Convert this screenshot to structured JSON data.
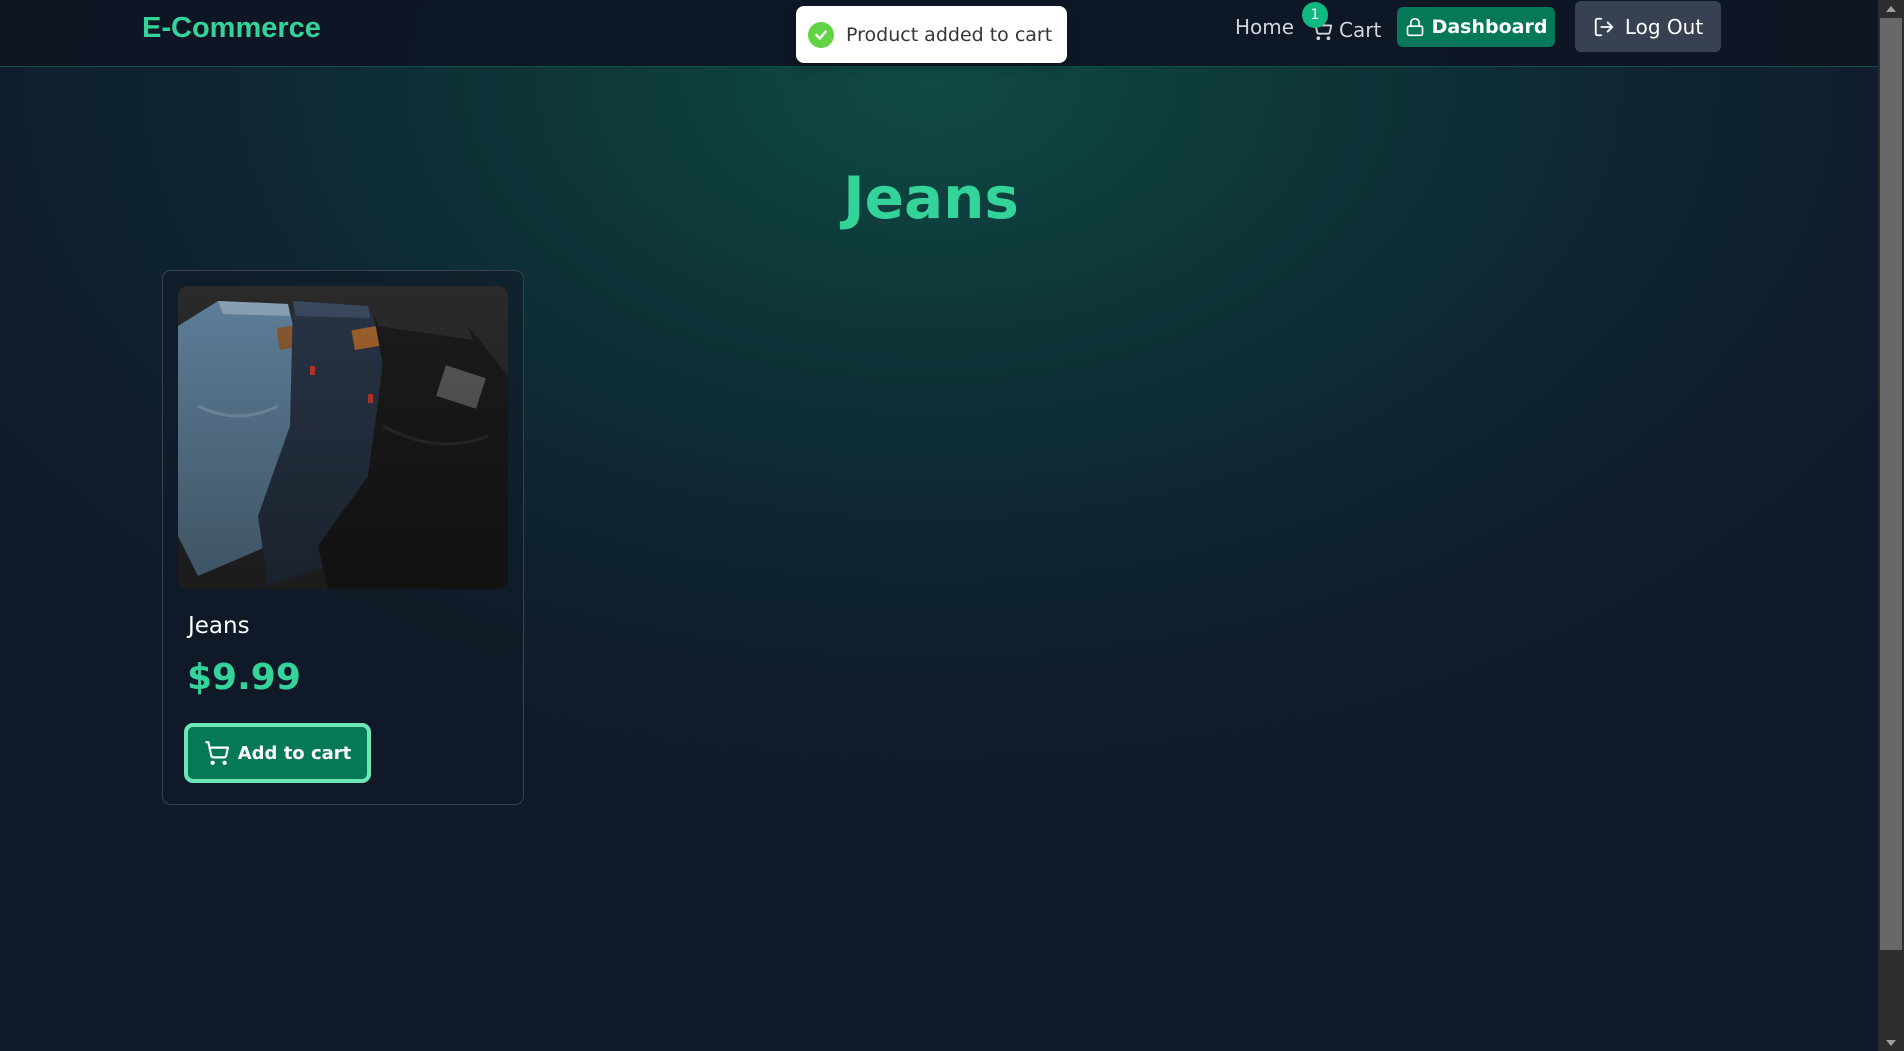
{
  "header": {
    "brand": "E-Commerce",
    "nav": {
      "home_label": "Home",
      "cart_label": "Cart",
      "cart_count": "1",
      "dashboard_label": "Dashboard",
      "logout_label": "Log Out"
    }
  },
  "toast": {
    "message": "Product added to cart",
    "icon": "check-circle-icon"
  },
  "page": {
    "title": "Jeans"
  },
  "products": [
    {
      "name": "Jeans",
      "price": "$9.99",
      "image_alt": "Jeans",
      "add_to_cart_label": "Add to cart"
    }
  ],
  "colors": {
    "accent": "#34d399",
    "button_primary": "#047857",
    "button_secondary": "#374151",
    "toast_success": "#61d345"
  }
}
